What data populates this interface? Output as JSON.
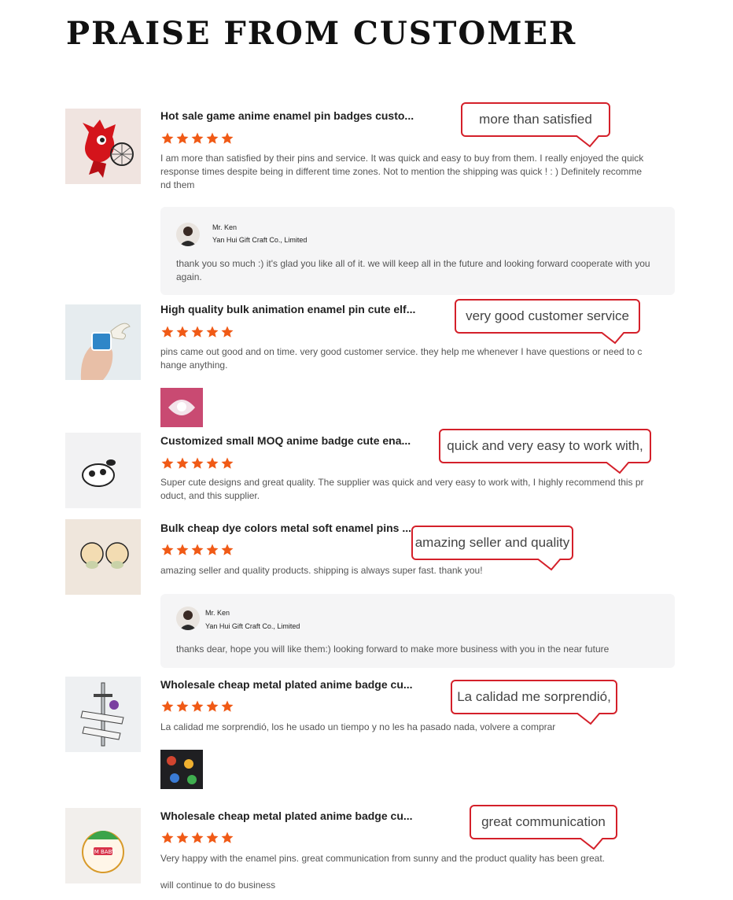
{
  "page": {
    "title": "PRAISE FROM CUSTOMER"
  },
  "colors": {
    "star": "#f05a16",
    "bubble_border": "#d4202a",
    "reply_bg": "#f5f5f6"
  },
  "reviews": [
    {
      "product": "Hot sale game anime enamel pin badges custo...",
      "rating": 5,
      "text": "I am more than satisfied by their pins and service. It was quick and easy to buy from them. I really enjoyed the quick response times despite being in different time zones. Not to mention the shipping was quick ! : ) Definitely recommend them",
      "bubble": "more than satisfied",
      "reply": {
        "name": "Mr. Ken",
        "company": "Yan Hui Gift Craft Co., Limited",
        "message": "thank you so much :) it's glad you like all of it. we will keep all in the future and looking forward cooperate with you again."
      }
    },
    {
      "product": "High quality bulk animation enamel pin cute elf...",
      "rating": 5,
      "text": "pins came out good and on time. very good customer service. they help me whenever I have questions or need to change anything.",
      "bubble": "very good customer service"
    },
    {
      "product": "Customized small MOQ anime badge cute ena...",
      "rating": 5,
      "text": "Super cute designs and great quality. The supplier was quick and very easy to work with, I highly recommend this product, and this supplier.",
      "bubble": "quick and very easy to work with,"
    },
    {
      "product": "Bulk cheap dye colors metal soft enamel pins ...",
      "rating": 5,
      "text": "amazing seller and quality products.  shipping is always super fast.  thank you!",
      "bubble": "amazing seller and quality",
      "reply": {
        "name": "Mr. Ken",
        "company": "Yan Hui Gift Craft Co., Limited",
        "message": "thanks dear, hope you will like them:) looking forward to make more business with you in the near future"
      }
    },
    {
      "product": "Wholesale cheap metal plated anime badge cu...",
      "rating": 5,
      "text": "La calidad me sorprendió, los he usado un tiempo y no les ha pasado nada, volvere a comprar",
      "bubble": "La calidad me sorprendió,"
    },
    {
      "product": "Wholesale cheap metal plated anime badge cu...",
      "rating": 5,
      "text": "Very happy with the enamel pins. great communication from sunny and the product quality has been great.",
      "text2": "will continue to do business",
      "bubble": "great communication",
      "badge_text": "I'M BABY"
    }
  ]
}
